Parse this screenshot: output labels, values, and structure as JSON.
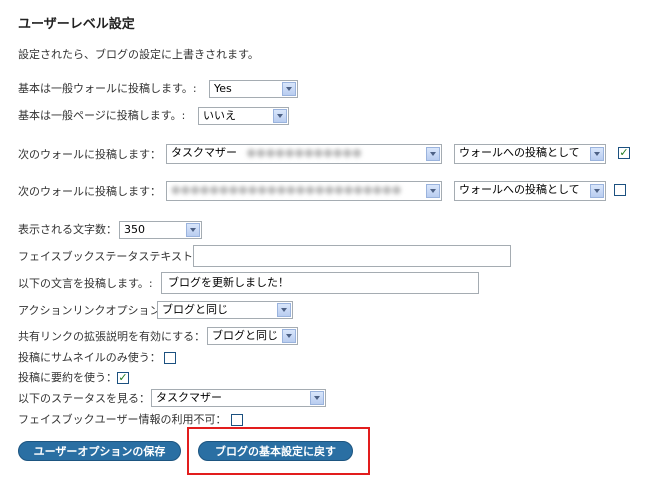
{
  "title": "ユーザーレベル設定",
  "description": "設定されたら、ブログの設定に上書きされます。",
  "rows": {
    "wall_default": {
      "label": "基本は一般ウォールに投稿します。:",
      "value": "Yes"
    },
    "page_default": {
      "label": "基本は一般ページに投稿します。:",
      "value": "いいえ"
    },
    "next_wall_1": {
      "label": "次のウォールに投稿します：",
      "value": "タスクマザー",
      "mode": "ウォールへの投稿として",
      "checked": "✓"
    },
    "next_wall_2": {
      "label": "次のウォールに投稿します：",
      "mode": "ウォールへの投稿として",
      "checked": ""
    },
    "char_count": {
      "label": "表示される文字数：",
      "value": "350"
    },
    "fb_status_text": {
      "label": "フェイスブックステータステキスト：",
      "value": ""
    },
    "post_text": {
      "label": "以下の文言を投稿します。:",
      "value": "ブログを更新しました！"
    },
    "action_link": {
      "label": "アクションリンクオプション：",
      "value": "ブログと同じ"
    },
    "share_link": {
      "label": "共有リンクの拡張説明を有効にする：",
      "value": "ブログと同じ"
    },
    "thumbnail_only": {
      "label": "投稿にサムネイルのみ使う：",
      "checked": ""
    },
    "use_summary": {
      "label": "投稿に要約を使う：",
      "checked": "✓"
    },
    "view_status": {
      "label": "以下のステータスを見る：",
      "value": "タスクマザー"
    },
    "fb_user_info": {
      "label": "フェイスブックユーザー情報の利用不可：",
      "checked": ""
    }
  },
  "buttons": {
    "save": "ユーザーオプションの保存",
    "reset": "ブログの基本設定に戻す"
  },
  "colors": {
    "button": "#2a6fa3",
    "highlight": "#e21d1d"
  }
}
